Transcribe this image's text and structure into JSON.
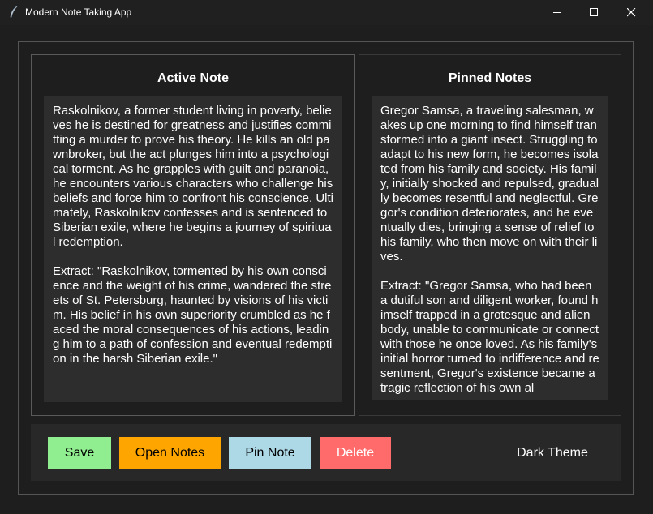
{
  "window": {
    "title": "Modern Note Taking App"
  },
  "active_note": {
    "heading": "Active Note",
    "text": "Raskolnikov, a former student living in poverty, believes he is destined for greatness and justifies committing a murder to prove his theory. He kills an old pawnbroker, but the act plunges him into a psychological torment. As he grapples with guilt and paranoia, he encounters various characters who challenge his beliefs and force him to confront his conscience. Ultimately, Raskolnikov confesses and is sentenced to Siberian exile, where he begins a journey of spiritual redemption.\n\nExtract: \"Raskolnikov, tormented by his own conscience and the weight of his crime, wandered the streets of St. Petersburg, haunted by visions of his victim. His belief in his own superiority crumbled as he faced the moral consequences of his actions, leading him to a path of confession and eventual redemption in the harsh Siberian exile.\""
  },
  "pinned_notes": {
    "heading": "Pinned Notes",
    "text": "Gregor Samsa, a traveling salesman, wakes up one morning to find himself transformed into a giant insect. Struggling to adapt to his new form, he becomes isolated from his family and society. His family, initially shocked and repulsed, gradually becomes resentful and neglectful. Gregor's condition deteriorates, and he eventually dies, bringing a sense of relief to his family, who then move on with their lives.\n\nExtract: \"Gregor Samsa, who had been a dutiful son and diligent worker, found himself trapped in a grotesque and alien body, unable to communicate or connect with those he once loved. As his family's initial horror turned to indifference and resentment, Gregor's existence became a tragic reflection of his own al"
  },
  "buttons": {
    "save": "Save",
    "open": "Open Notes",
    "pin": "Pin Note",
    "delete": "Delete",
    "theme": "Dark Theme"
  },
  "colors": {
    "save": "#90ee90",
    "open": "#ffa500",
    "pin": "#add8e6",
    "delete": "#ff6b6b"
  }
}
